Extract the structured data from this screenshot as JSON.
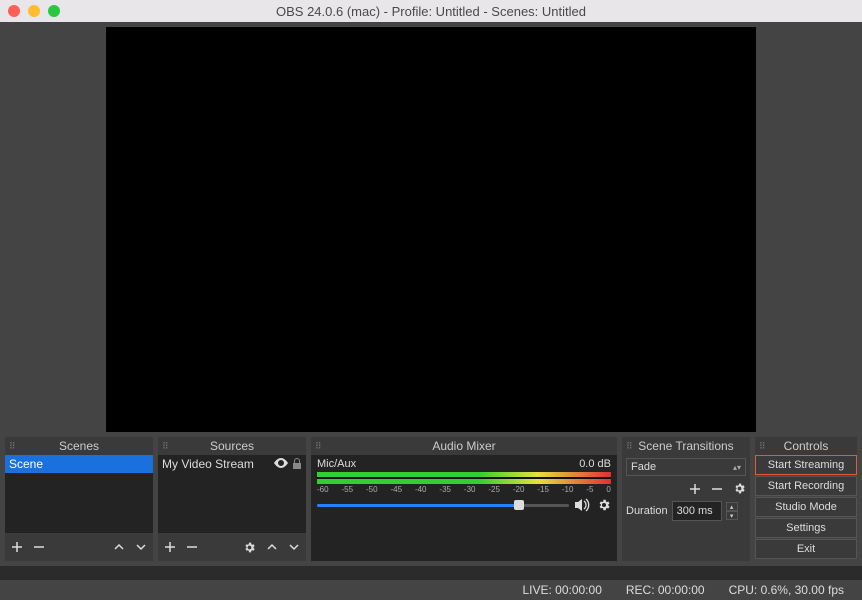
{
  "window": {
    "title": "OBS 24.0.6 (mac) - Profile: Untitled - Scenes: Untitled"
  },
  "panels": {
    "scenes": {
      "title": "Scenes",
      "items": [
        "Scene"
      ]
    },
    "sources": {
      "title": "Sources",
      "items": [
        "My Video Stream"
      ]
    },
    "mixer": {
      "title": "Audio Mixer",
      "channel": "Mic/Aux",
      "level": "0.0 dB",
      "ticks": [
        "-60",
        "-55",
        "-50",
        "-45",
        "-40",
        "-35",
        "-30",
        "-25",
        "-20",
        "-15",
        "-10",
        "-5",
        "0"
      ]
    },
    "transitions": {
      "title": "Scene Transitions",
      "selected": "Fade",
      "duration_label": "Duration",
      "duration_value": "300 ms"
    },
    "controls": {
      "title": "Controls",
      "buttons": {
        "start_streaming": "Start Streaming",
        "start_recording": "Start Recording",
        "studio_mode": "Studio Mode",
        "settings": "Settings",
        "exit": "Exit"
      }
    }
  },
  "status": {
    "live": "LIVE: 00:00:00",
    "rec": "REC: 00:00:00",
    "cpu": "CPU: 0.6%, 30.00 fps"
  }
}
